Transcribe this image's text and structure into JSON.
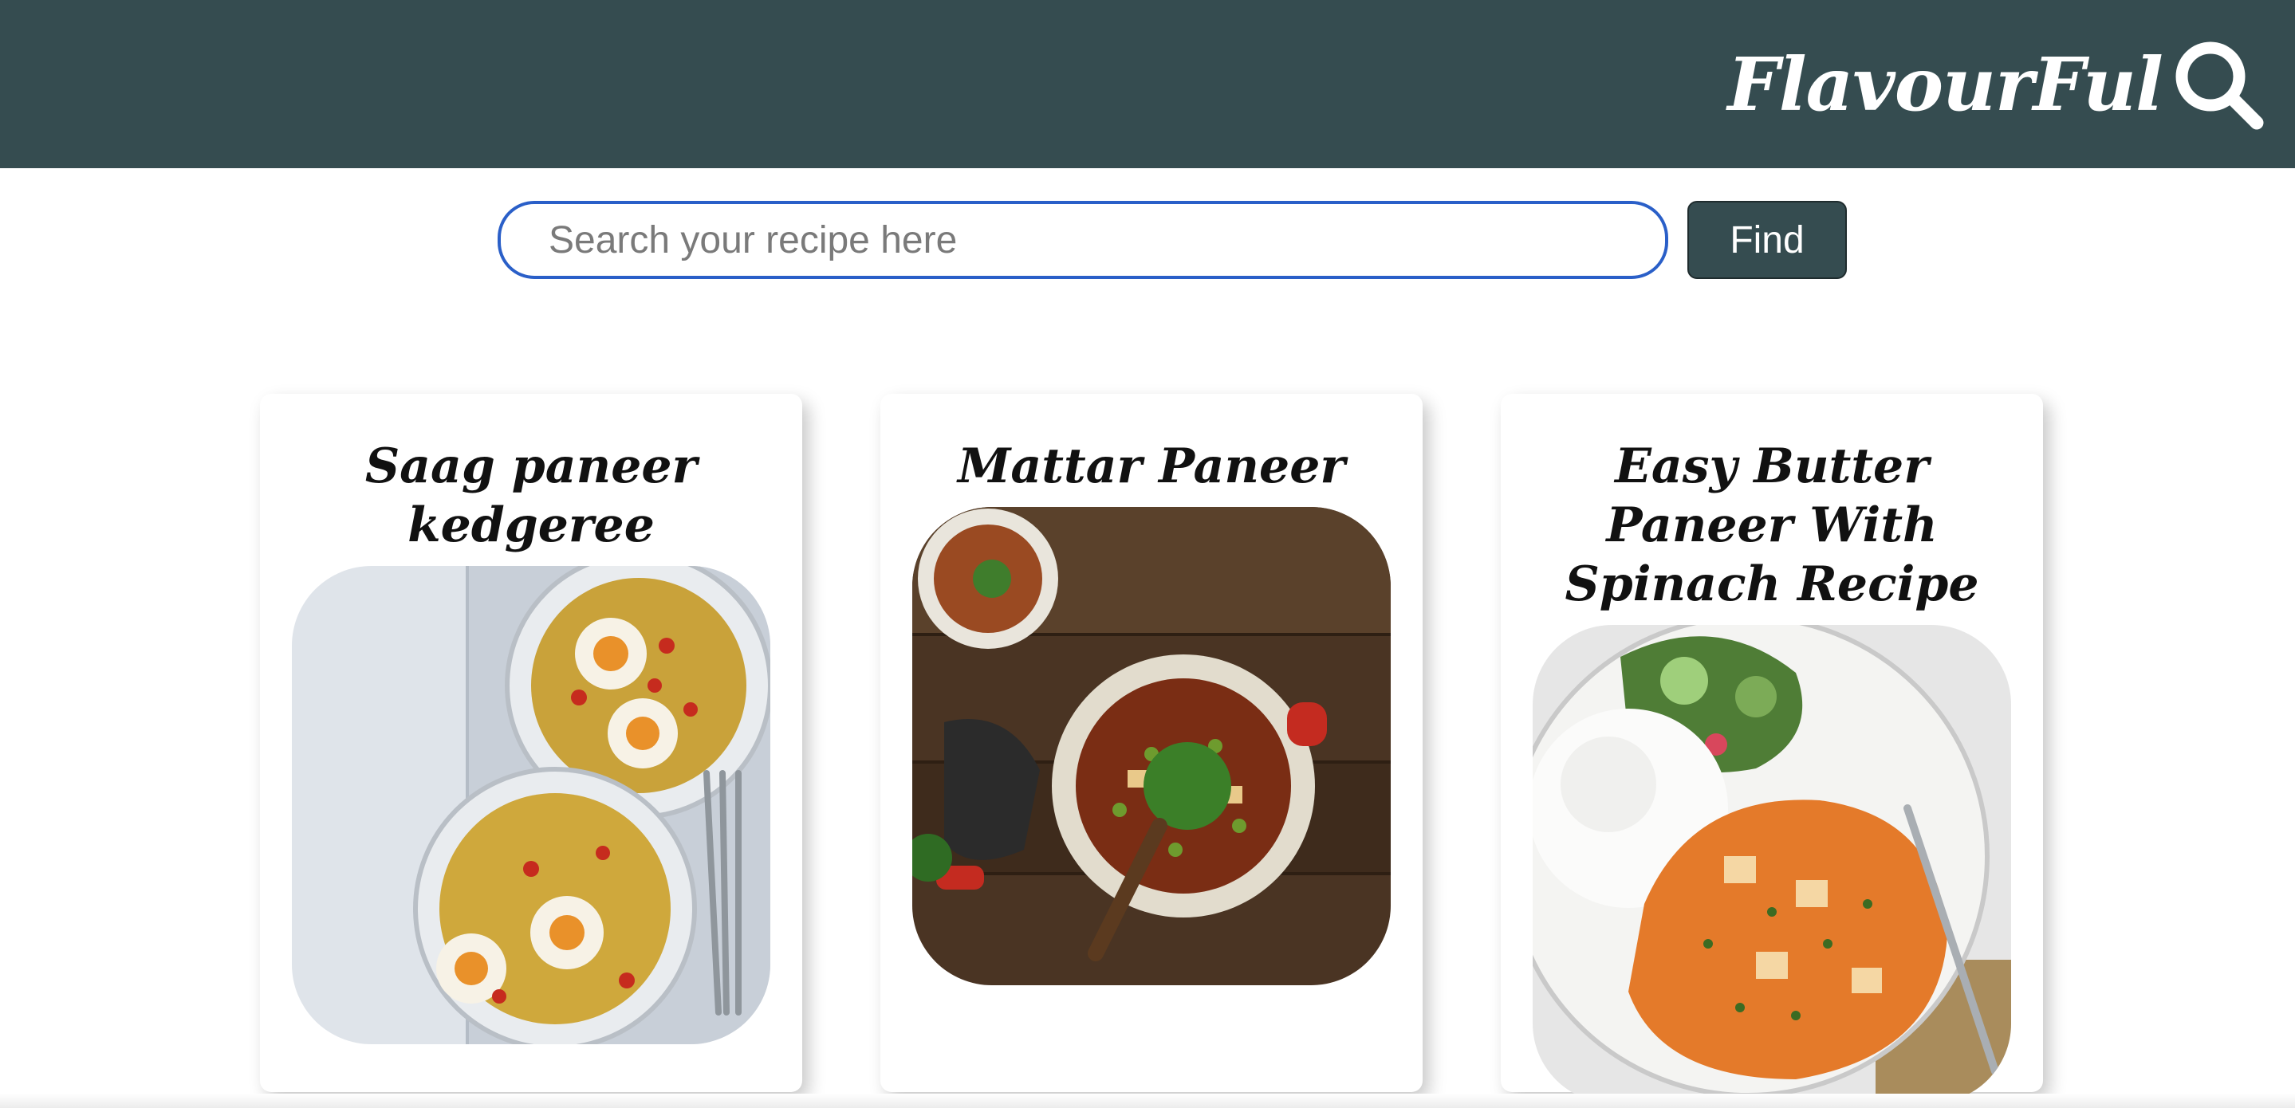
{
  "header": {
    "brand": "FlavourFul",
    "brand_icon": "search-icon",
    "background_color": "#354c50"
  },
  "search": {
    "placeholder": "Search your recipe here",
    "value": "",
    "button_label": "Find",
    "focus_color": "#2a5fc8"
  },
  "recipes": [
    {
      "title": "Saag paneer kedgeree",
      "image": "bowls of rice noodles with boiled eggs and chillies"
    },
    {
      "title": "Mattar Paneer",
      "image": "pot of pea and paneer curry with coriander"
    },
    {
      "title": "Easy Butter Paneer With Spinach Recipe",
      "image": "plate of butter paneer with rice and salad"
    }
  ]
}
